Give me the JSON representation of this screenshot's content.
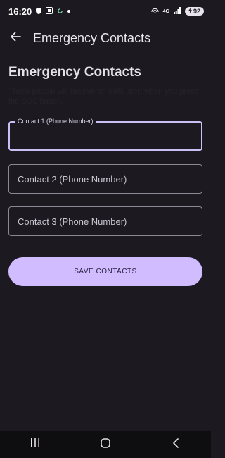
{
  "status": {
    "time": "16:20",
    "network": "4G",
    "battery": "92"
  },
  "appbar": {
    "title": "Emergency Contacts",
    "back_icon": "arrow-left-icon"
  },
  "main": {
    "heading": "Emergency Contacts",
    "description": "These people will receive an SMS alert when you press the SOS button.",
    "fields": [
      {
        "label": "Contact 1 (Phone Number)",
        "value": "",
        "focused": true
      },
      {
        "label": "Contact 2 (Phone Number)",
        "value": ""
      },
      {
        "label": "Contact 3 (Phone Number)",
        "value": ""
      }
    ],
    "save_label": "SAVE CONTACTS"
  },
  "navbar": {
    "icons": [
      "recents-icon",
      "home-icon",
      "back-icon"
    ]
  },
  "colors": {
    "background": "#1c1a20",
    "accent": "#d0bcff",
    "focused_outline": "#cbc0f5",
    "outline": "#8d8795"
  }
}
